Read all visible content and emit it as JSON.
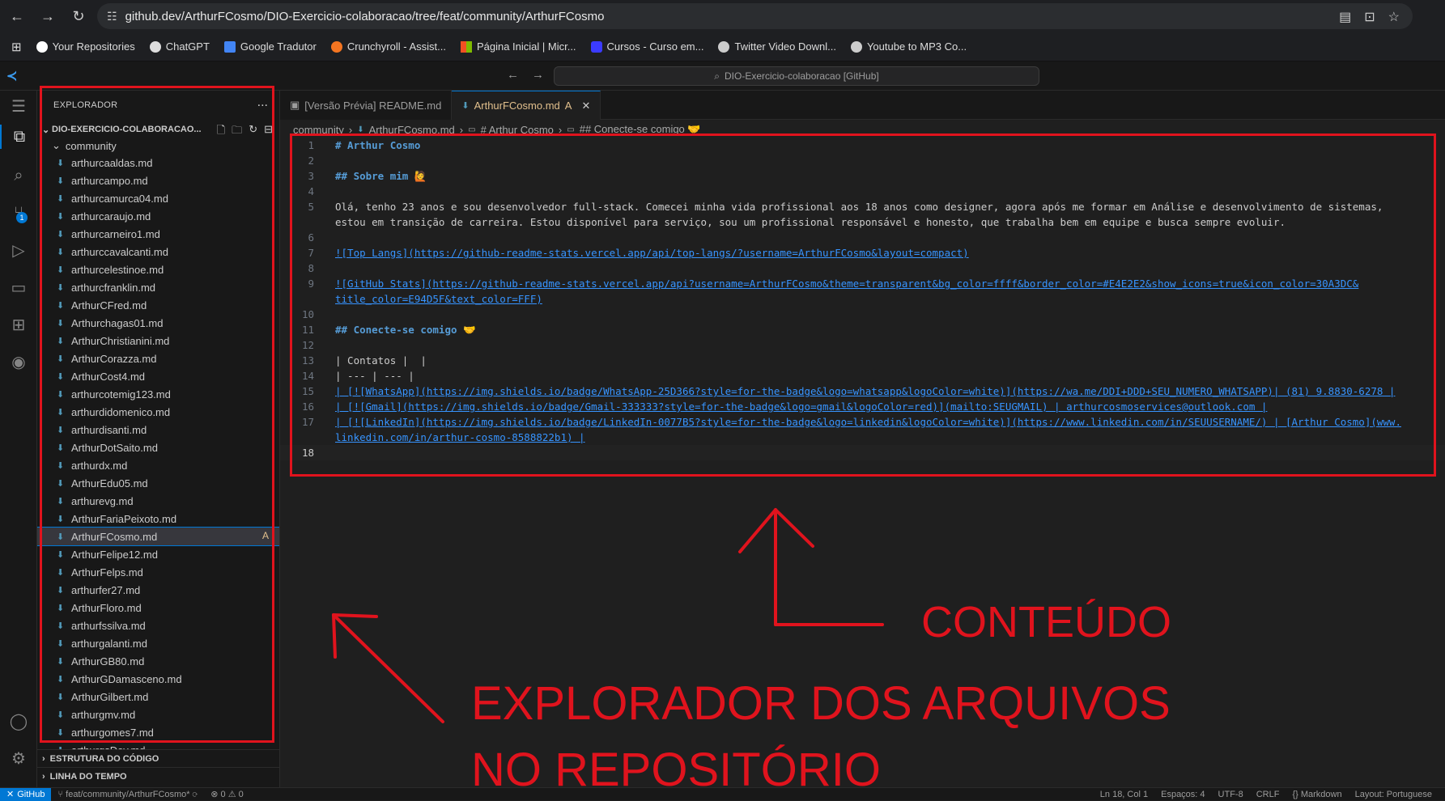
{
  "browser": {
    "url": "github.dev/ArthurFCosmo/DIO-Exercicio-colaboracao/tree/feat/community/ArthurFCosmo",
    "bookmarks": [
      {
        "label": "Your Repositories",
        "icon": "github-icon",
        "color": "#ffffff"
      },
      {
        "label": "ChatGPT",
        "icon": "chatgpt-icon",
        "color": "#dddddd"
      },
      {
        "label": "Google Tradutor",
        "icon": "translate-icon",
        "color": "#4285f4"
      },
      {
        "label": "Crunchyroll - Assist...",
        "icon": "crunchyroll-icon",
        "color": "#f47521"
      },
      {
        "label": "Página Inicial | Micr...",
        "icon": "microsoft-icon",
        "color": "#f25022"
      },
      {
        "label": "Cursos - Curso em...",
        "icon": "course-icon",
        "color": "#3b3bff"
      },
      {
        "label": "Twitter Video Downl...",
        "icon": "download-icon",
        "color": "#cccccc"
      },
      {
        "label": "Youtube to MP3 Co...",
        "icon": "music-icon",
        "color": "#cccccc"
      }
    ]
  },
  "vscode": {
    "command_center": "DIO-Exercicio-colaboracao [GitHub]",
    "activity_badge": "1"
  },
  "sidebar": {
    "title": "EXPLORADOR",
    "more": "...",
    "repo": "DIO-EXERCICIO-COLABORACAO...",
    "folder": "community",
    "files": [
      "arthurcaaldas.md",
      "arthurcampo.md",
      "arthurcamurca04.md",
      "arthurcaraujo.md",
      "arthurcarneiro1.md",
      "arthurccavalcanti.md",
      "arthurcelestinoe.md",
      "arthurcfranklin.md",
      "ArthurCFred.md",
      "Arthurchagas01.md",
      "ArthurChristianini.md",
      "ArthurCorazza.md",
      "ArthurCost4.md",
      "arthurcotemig123.md",
      "arthurdidomenico.md",
      "arthurdisanti.md",
      "ArthurDotSaito.md",
      "arthurdx.md",
      "ArthurEdu05.md",
      "arthurevg.md",
      "ArthurFariaPeixoto.md",
      "ArthurFCosmo.md",
      "ArthurFelipe12.md",
      "ArthurFelps.md",
      "arthurfer27.md",
      "ArthurFloro.md",
      "arthurfssilva.md",
      "arthurgalanti.md",
      "ArthurGB80.md",
      "ArthurGDamasceno.md",
      "ArthurGilbert.md",
      "arthurgmv.md",
      "arthurgomes7.md",
      "arthurgsDev.md"
    ],
    "active_file_status": "A",
    "outline_label": "ESTRUTURA DO CÓDIGO",
    "timeline_label": "LINHA DO TEMPO"
  },
  "editor": {
    "tabs": [
      {
        "label": "[Versão Prévia] README.md",
        "status": ""
      },
      {
        "label": "ArthurFCosmo.md",
        "status": "A"
      }
    ],
    "breadcrumb": [
      "community",
      "ArthurFCosmo.md",
      "# Arthur Cosmo",
      "## Conecte-se comigo 🤝"
    ],
    "lines": [
      {
        "n": "1",
        "text": "# Arthur Cosmo"
      },
      {
        "n": "2",
        "text": ""
      },
      {
        "n": "3",
        "text": "## Sobre mim 🙋"
      },
      {
        "n": "4",
        "text": ""
      },
      {
        "n": "5",
        "text": "Olá, tenho 23 anos e sou desenvolvedor full-stack. Comecei minha vida profissional aos 18 anos como designer, agora após me formar em Análise e desenvolvimento de sistemas,"
      },
      {
        "n": "",
        "text": "estou em transição de carreira. Estou disponível para serviço, sou um profissional responsável e honesto, que trabalha bem em equipe e busca sempre evoluir."
      },
      {
        "n": "6",
        "text": ""
      },
      {
        "n": "7",
        "text": "![Top Langs](https://github-readme-stats.vercel.app/api/top-langs/?username=ArthurFCosmo&layout=compact)"
      },
      {
        "n": "8",
        "text": ""
      },
      {
        "n": "9",
        "text": "![GitHub Stats](https://github-readme-stats.vercel.app/api?username=ArthurFCosmo&theme=transparent&bg_color=ffff&border_color=#E4E2E2&show_icons=true&icon_color=30A3DC&"
      },
      {
        "n": "",
        "text": "title_color=E94D5F&text_color=FFF)"
      },
      {
        "n": "10",
        "text": ""
      },
      {
        "n": "11",
        "text": "## Conecte-se comigo 🤝"
      },
      {
        "n": "12",
        "text": ""
      },
      {
        "n": "13",
        "text": "| Contatos |  |"
      },
      {
        "n": "14",
        "text": "| --- | --- |"
      },
      {
        "n": "15",
        "text": "| [![WhatsApp](https://img.shields.io/badge/WhatsApp-25D366?style=for-the-badge&logo=whatsapp&logoColor=white)](https://wa.me/DDI+DDD+SEU_NUMERO_WHATSAPP)| (81) 9.8830-6278 |"
      },
      {
        "n": "16",
        "text": "| [![Gmail](https://img.shields.io/badge/Gmail-333333?style=for-the-badge&logo=gmail&logoColor=red)](mailto:SEUGMAIL) | arthurcosmoservices@outlook.com |"
      },
      {
        "n": "17",
        "text": "| [![LinkedIn](https://img.shields.io/badge/LinkedIn-0077B5?style=for-the-badge&logo=linkedin&logoColor=white)](https://www.linkedin.com/in/SEUUSERNAME/) | [Arthur Cosmo](www."
      },
      {
        "n": "",
        "text": "linkedin.com/in/arthur-cosmo-8588822b1) |"
      },
      {
        "n": "18",
        "text": ""
      }
    ]
  },
  "annotations": {
    "content_label": "CONTEÚDO",
    "explorer_label_1": "EXPLORADOR DOS ARQUIVOS",
    "explorer_label_2": "NO REPOSITÓRIO",
    "color": "#e0131d"
  },
  "statusbar": {
    "remote": "GitHub",
    "branch": "feat/community/ArthurFCosmo*",
    "problems": "⊗ 0 ⚠ 0",
    "right": [
      "Ln 18, Col 1",
      "Espaços: 4",
      "UTF-8",
      "CRLF",
      "{} Markdown",
      "Layout: Portuguese"
    ]
  }
}
